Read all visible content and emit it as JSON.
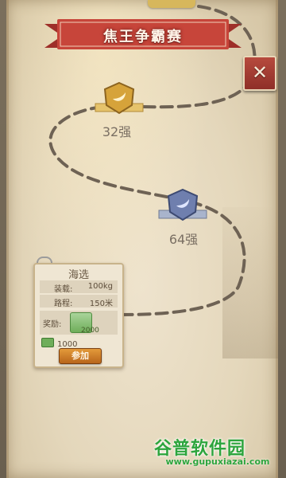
{
  "title": "焦王争霸赛",
  "close": {
    "label": "✕"
  },
  "ranks": [
    {
      "label": "32强"
    },
    {
      "label": "64强"
    }
  ],
  "card": {
    "title": "海选",
    "rows": [
      {
        "key": "装载:",
        "value": "100kg"
      },
      {
        "key": "路程:",
        "value": "150米"
      }
    ],
    "reward_label": "奖励:",
    "reward_qty": "2000",
    "cost": "1000",
    "join_label": "参加"
  },
  "watermark": {
    "brand": "谷普软件园",
    "url": "www.gupuxiazai.com"
  }
}
